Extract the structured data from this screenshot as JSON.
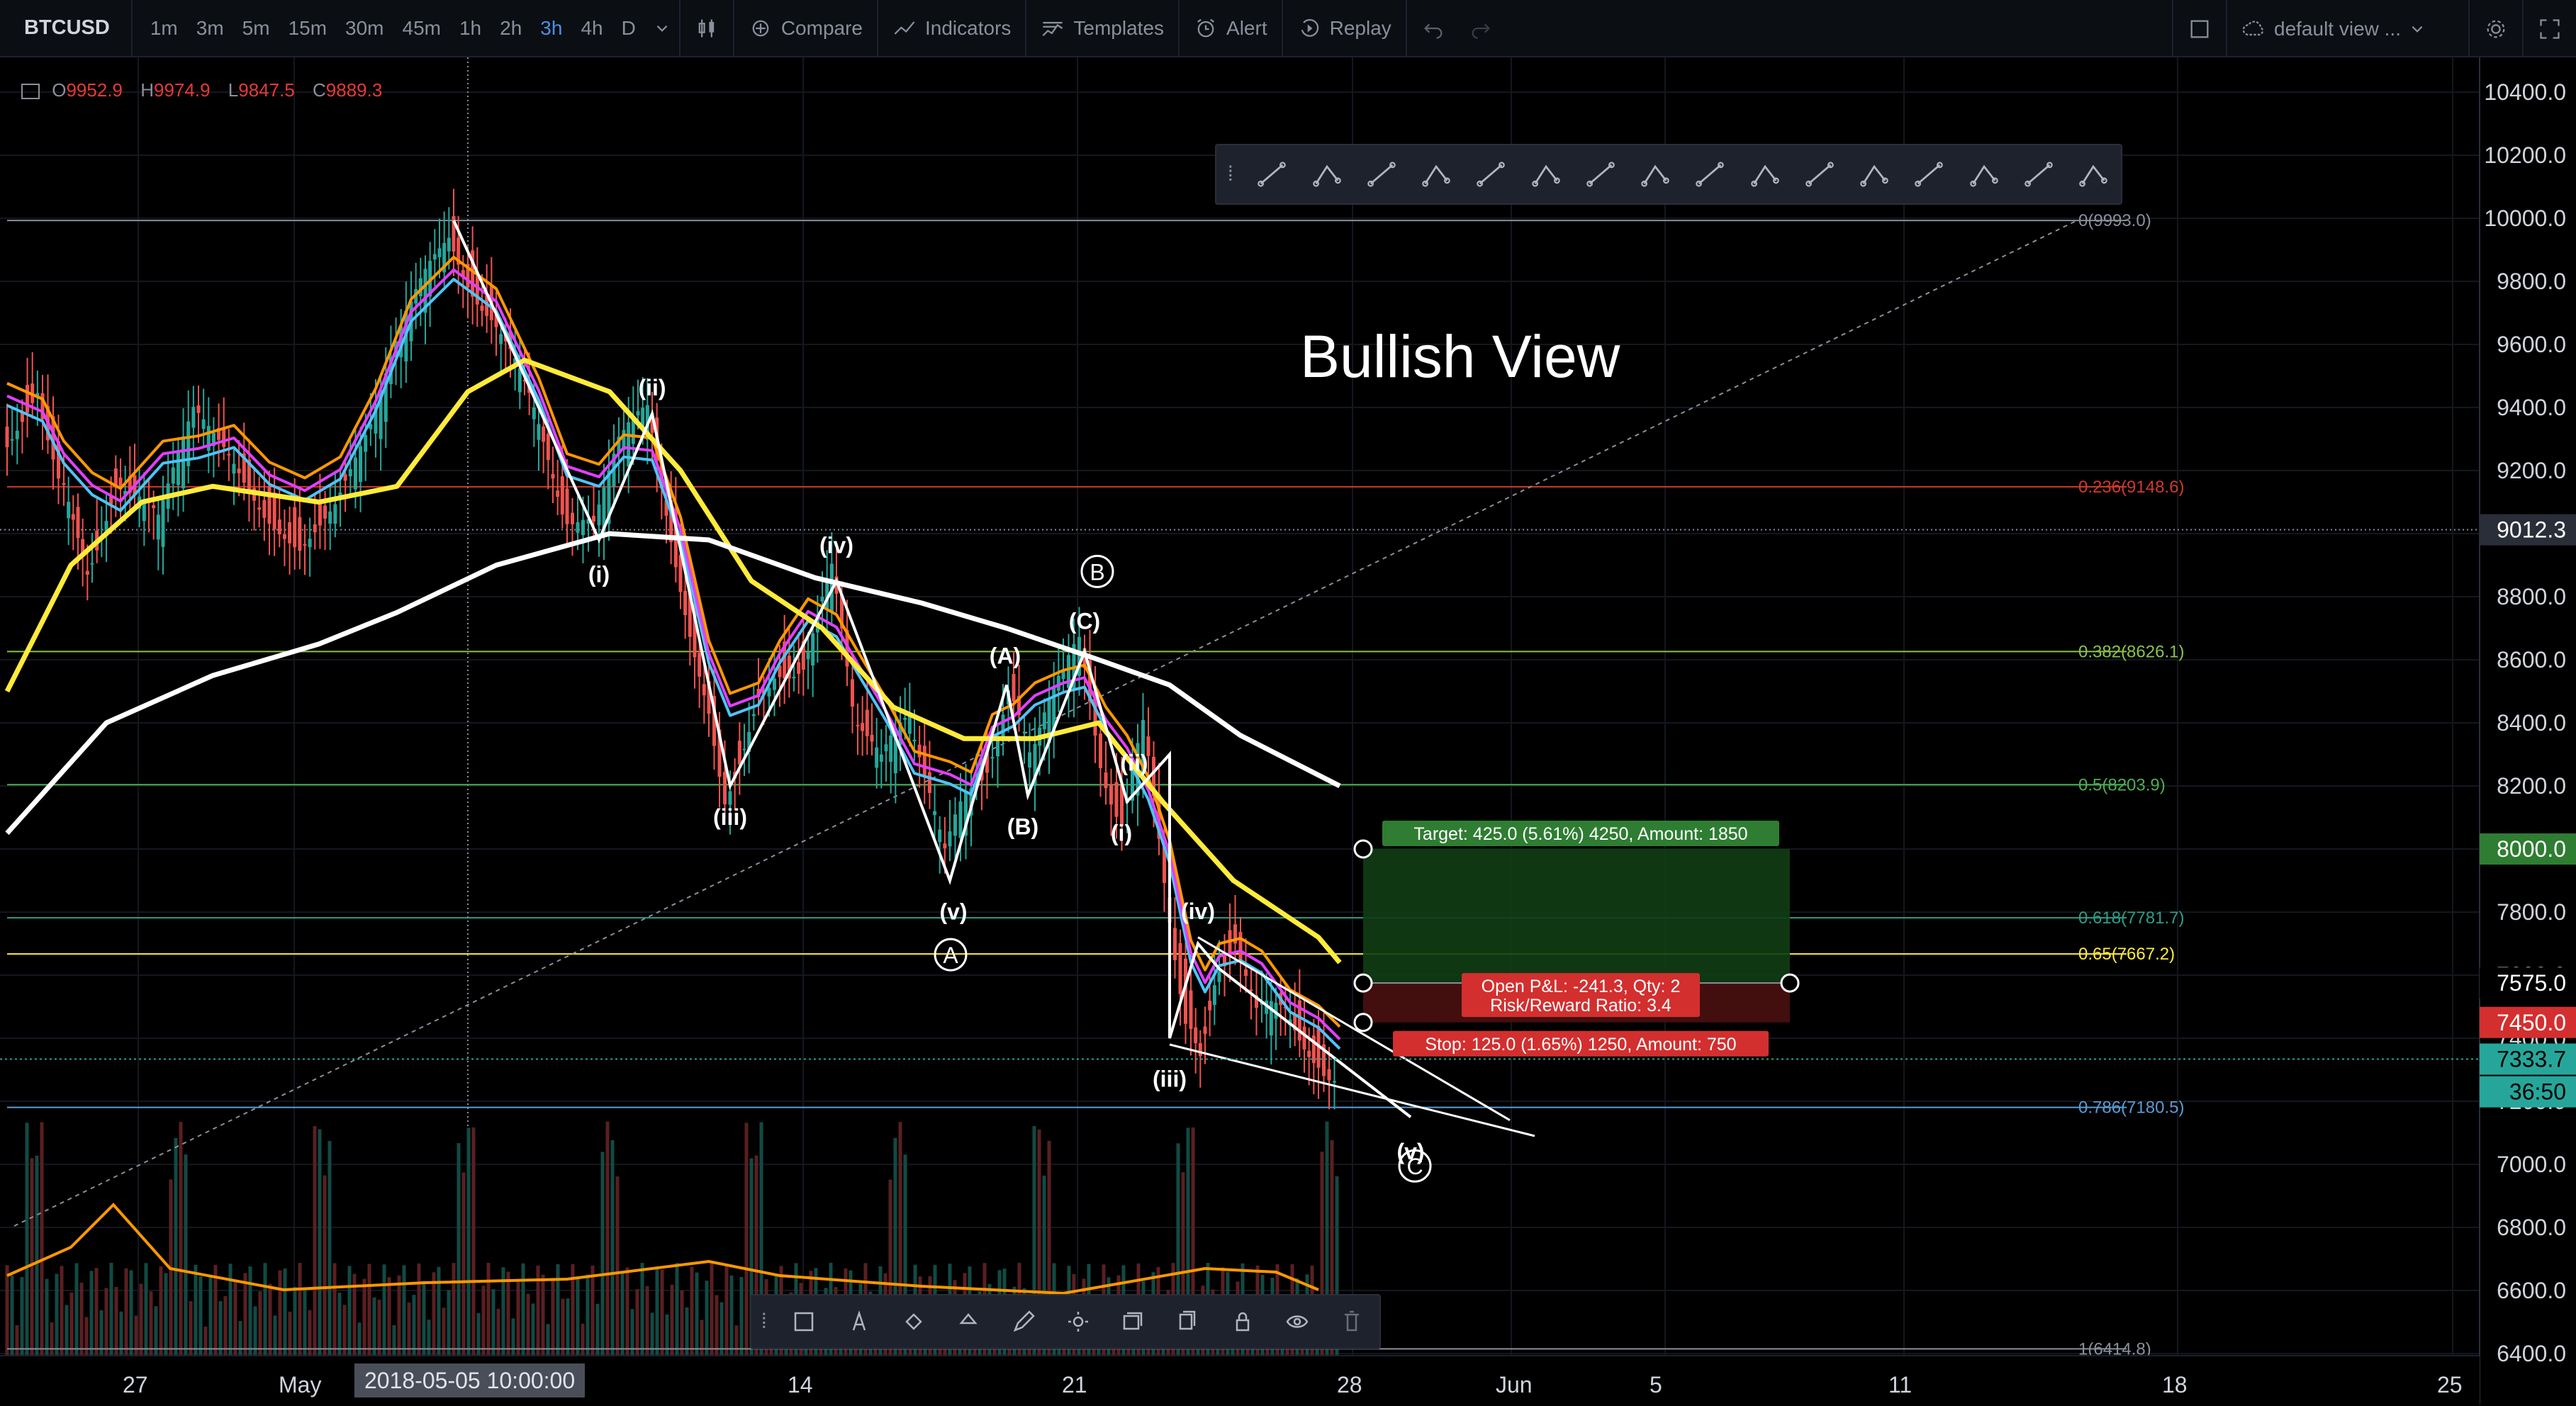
{
  "toolbar": {
    "symbol": "BTCUSD",
    "intervals": [
      "1m",
      "3m",
      "5m",
      "15m",
      "30m",
      "45m",
      "1h",
      "2h",
      "3h",
      "4h",
      "D"
    ],
    "active_interval": "3h",
    "compare_label": "Compare",
    "indicators_label": "Indicators",
    "templates_label": "Templates",
    "alert_label": "Alert",
    "replay_label": "Replay",
    "view_label": "default view ..."
  },
  "ohlc": {
    "o_label": "O",
    "o": "9952.9",
    "h_label": "H",
    "h": "9974.9",
    "l_label": "L",
    "l": "9847.5",
    "c_label": "C",
    "c": "9889.3"
  },
  "annotation": {
    "title": "Bullish View"
  },
  "price_axis": [
    "10400.0",
    "10200.0",
    "10000.0",
    "9800.0",
    "9600.0",
    "9400.0",
    "9200.0",
    "9000.0",
    "8800.0",
    "8600.0",
    "8400.0",
    "8200.0",
    "8000.0",
    "7800.0",
    "7600.0",
    "7400.0",
    "7200.0",
    "7000.0",
    "6800.0",
    "6600.0",
    "6400.0"
  ],
  "price_tags": {
    "crosshair": "9012.3",
    "target": "8000.0",
    "entry": "7575.0",
    "stop": "7450.0",
    "last": "7333.7",
    "countdown": "36:50"
  },
  "date_axis": [
    "27",
    "May",
    "14",
    "21",
    "28",
    "Jun",
    "5",
    "11",
    "18",
    "25"
  ],
  "crosshair_date": "2018-05-05 10:00:00",
  "fib_levels": [
    {
      "label": "0(9993.0)",
      "color": "#8a8f9c"
    },
    {
      "label": "0.236(9148.6)",
      "color": "#d0392b"
    },
    {
      "label": "0.382(8626.1)",
      "color": "#8bc34a"
    },
    {
      "label": "0.5(8203.9)",
      "color": "#4caf50"
    },
    {
      "label": "0.618(7781.7)",
      "color": "#2e9d8a"
    },
    {
      "label": "0.65(7667.2)",
      "color": "#ffeb3b"
    },
    {
      "label": "0.786(7180.5)",
      "color": "#5b9bd5"
    },
    {
      "label": "1(6414.8)",
      "color": "#8a8f9c"
    }
  ],
  "waves": [
    "(i)",
    "(ii)",
    "(iii)",
    "(iv)",
    "(v)",
    "(A)",
    "(B)",
    "(C)",
    "(i)",
    "(ii)",
    "(iii)",
    "(iv)",
    "(v)"
  ],
  "circled_waves": [
    "A",
    "B",
    "C"
  ],
  "position": {
    "target": "Target: 425.0 (5.61%) 4250, Amount: 1850",
    "pnl": "Open P&L: -241.3, Qty: 2",
    "rr": "Risk/Reward Ratio: 3.4",
    "stop": "Stop: 125.0 (1.65%) 1250, Amount: 750"
  },
  "colors": {
    "bg": "#000000",
    "up": "#26a69a",
    "down": "#ef5350",
    "ema_fast": "#4fc3f7",
    "ema2": "#e040fb",
    "ema3": "#ff9800",
    "ema_yellow": "#ffeb3b",
    "ma_white": "#ffffff",
    "volume_ma": "#ff9800"
  },
  "chart_data": {
    "type": "line",
    "title": "Bullish View",
    "xlabel": "",
    "ylabel": "",
    "ylim": [
      6400,
      10400
    ],
    "x": [
      "27",
      "May",
      "14",
      "21",
      "28",
      "Jun"
    ],
    "series": [
      {
        "name": "",
        "values": [
          9300,
          9100,
          9800,
          9400,
          8900,
          9100,
          8200,
          8800,
          7900,
          8450,
          8600,
          7400,
          7700,
          7330,
          7150
        ]
      }
    ]
  }
}
